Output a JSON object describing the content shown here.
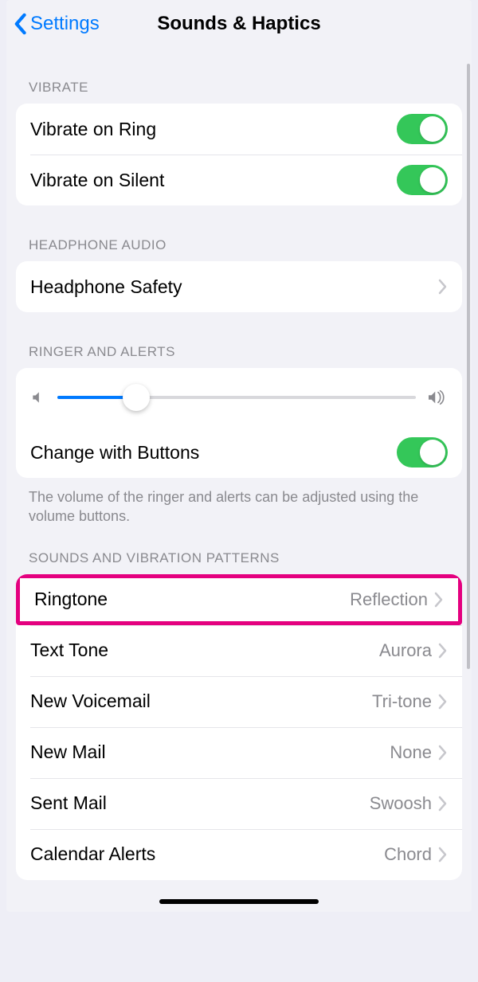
{
  "nav": {
    "back_label": "Settings",
    "title": "Sounds & Haptics"
  },
  "sections": {
    "vibrate": {
      "header": "VIBRATE",
      "rows": {
        "ring": {
          "label": "Vibrate on Ring",
          "on": true
        },
        "silent": {
          "label": "Vibrate on Silent",
          "on": true
        }
      }
    },
    "headphone": {
      "header": "HEADPHONE AUDIO",
      "rows": {
        "safety": {
          "label": "Headphone Safety"
        }
      }
    },
    "ringer": {
      "header": "RINGER AND ALERTS",
      "slider_pct": 22,
      "change_buttons": {
        "label": "Change with Buttons",
        "on": true
      },
      "footer": "The volume of the ringer and alerts can be adjusted using the volume buttons."
    },
    "patterns": {
      "header": "SOUNDS AND VIBRATION PATTERNS",
      "rows": [
        {
          "label": "Ringtone",
          "value": "Reflection",
          "highlight": true
        },
        {
          "label": "Text Tone",
          "value": "Aurora"
        },
        {
          "label": "New Voicemail",
          "value": "Tri-tone"
        },
        {
          "label": "New Mail",
          "value": "None"
        },
        {
          "label": "Sent Mail",
          "value": "Swoosh"
        },
        {
          "label": "Calendar Alerts",
          "value": "Chord"
        }
      ]
    }
  }
}
